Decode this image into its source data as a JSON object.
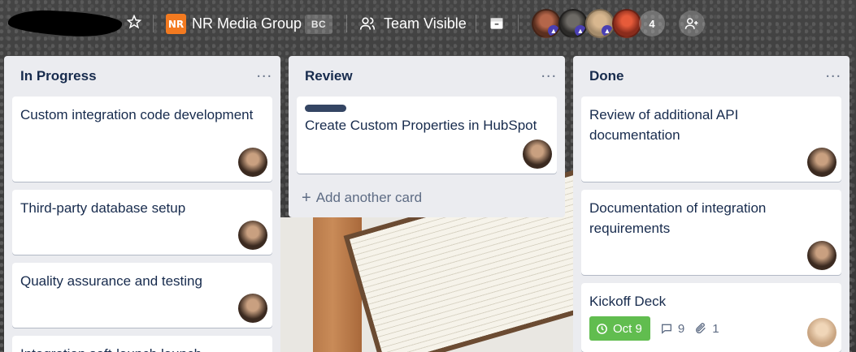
{
  "header": {
    "workspace_logo": "NR",
    "workspace_name": "NR Media Group",
    "workspace_badge": "BC",
    "visibility_label": "Team Visible",
    "member_count": "4",
    "icons": [
      "star-icon",
      "team-icon",
      "archive-icon",
      "add-member-icon"
    ]
  },
  "lists": [
    {
      "title": "In Progress",
      "cards": [
        {
          "title": "Custom integration code development"
        },
        {
          "title": "Third-party database setup"
        },
        {
          "title": "Quality assurance and testing"
        },
        {
          "title": "Integration soft-launch launch"
        }
      ]
    },
    {
      "title": "Review",
      "cards": [
        {
          "title": "Create Custom Properties in HubSpot"
        }
      ],
      "add_card": "Add another card"
    },
    {
      "title": "Done",
      "cards": [
        {
          "title": "Review of additional API documentation"
        },
        {
          "title": "Documentation of integration requirements"
        },
        {
          "title": "Kickoff Deck",
          "due": "Oct 9",
          "comments": "9",
          "attachments": "1"
        }
      ]
    }
  ],
  "colors": {
    "list_bg": "#ebecf0",
    "label": "#344563",
    "due_complete": "#61bd4f",
    "workspace_logo": "#f37a20"
  }
}
